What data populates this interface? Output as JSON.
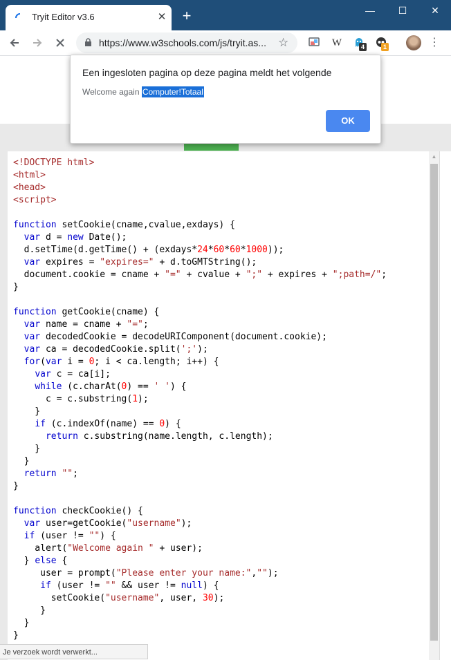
{
  "browser": {
    "tab_title": "Tryit Editor v3.6",
    "tab_close": "✕",
    "new_tab": "+",
    "url": "https://www.w3schools.com/js/tryit.as...",
    "window_buttons": {
      "minimize": "—",
      "maximize": "☐",
      "close": "✕"
    },
    "extensions": [
      {
        "icon": "cast-icon"
      },
      {
        "icon": "wikipedia-icon",
        "label": "W"
      },
      {
        "icon": "ghostery-icon",
        "badge": "4"
      },
      {
        "icon": "tampermonkey-icon",
        "badge": "1"
      }
    ],
    "status_text": "Je verzoek wordt verwerkt..."
  },
  "dialog": {
    "title": "Een ingesloten pagina op deze pagina meldt het volgende",
    "message_prefix": "Welcome again",
    "message_selected": "Computer!Totaal",
    "ok_label": "OK"
  },
  "code_lines": [
    "<!DOCTYPE html>",
    "<html>",
    "<head>",
    "<script>",
    "",
    "function setCookie(cname,cvalue,exdays) {",
    "  var d = new Date();",
    "  d.setTime(d.getTime() + (exdays*24*60*60*1000));",
    "  var expires = \"expires=\" + d.toGMTString();",
    "  document.cookie = cname + \"=\" + cvalue + \";\" + expires + \";path=/\";",
    "}",
    "",
    "function getCookie(cname) {",
    "  var name = cname + \"=\";",
    "  var decodedCookie = decodeURIComponent(document.cookie);",
    "  var ca = decodedCookie.split(';');",
    "  for(var i = 0; i < ca.length; i++) {",
    "    var c = ca[i];",
    "    while (c.charAt(0) == ' ') {",
    "      c = c.substring(1);",
    "    }",
    "    if (c.indexOf(name) == 0) {",
    "      return c.substring(name.length, c.length);",
    "    }",
    "  }",
    "  return \"\";",
    "}",
    "",
    "function checkCookie() {",
    "  var user=getCookie(\"username\");",
    "  if (user != \"\") {",
    "    alert(\"Welcome again \" + user);",
    "  } else {",
    "     user = prompt(\"Please enter your name:\",\"\");",
    "     if (user != \"\" && user != null) {",
    "       setCookie(\"username\", user, 30);",
    "     }",
    "  }",
    "}"
  ],
  "colors": {
    "titlebar": "#1f4e79",
    "run_button": "#4caf50",
    "dialog_ok": "#4a88f0",
    "selection": "#1a6fd8"
  }
}
